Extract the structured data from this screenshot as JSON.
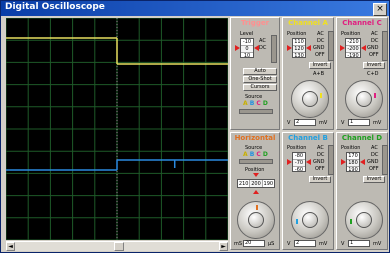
{
  "window": {
    "title": "Digital Oscilloscope",
    "close": "×"
  },
  "screen": {
    "trace_colors": {
      "A": "#e8e060",
      "B": "#2a8ae0"
    }
  },
  "scrollbar": {
    "left": "◄",
    "right": "►"
  },
  "trigger": {
    "title": "Trigger",
    "level_label": "Level",
    "level_values": [
      "-10",
      "0",
      "10"
    ],
    "ac": "AC",
    "dc": "DC",
    "auto": "Auto",
    "one_shot": "One-Shot",
    "cursors": "Cursors",
    "source_label": "Source",
    "source_letters": [
      "A",
      "B",
      "C",
      "D"
    ]
  },
  "channel_a": {
    "title": "Channel A",
    "color": "#f0e020",
    "position_label": "Position",
    "position_values": [
      "110",
      "120",
      "130"
    ],
    "modes": [
      "AC",
      "DC",
      "GND",
      "OFF"
    ],
    "invert": "Invert",
    "combo": "A+B",
    "scale_unit": "V",
    "scale_value": "2",
    "scale_small": "mV"
  },
  "channel_c": {
    "title": "Channel C",
    "color": "#e02080",
    "position_label": "Position",
    "position_values": [
      "-210",
      "-200",
      "-190"
    ],
    "modes": [
      "AC",
      "DC",
      "GND",
      "OFF"
    ],
    "invert": "Invert",
    "combo": "C+D",
    "scale_unit": "V",
    "scale_value": "1",
    "scale_small": "mV"
  },
  "horizontal": {
    "title": "Horizontal",
    "source_label": "Source",
    "source_letters": [
      "A",
      "B",
      "C",
      "D"
    ],
    "position_label": "Position",
    "position_values": [
      "210",
      "200",
      "190"
    ],
    "scale_unit": "mS",
    "scale_value": "20",
    "scale_small": "μS"
  },
  "channel_b": {
    "title": "Channel B",
    "color": "#20a0e0",
    "position_label": "Position",
    "position_values": [
      "-80",
      "-70",
      "-60"
    ],
    "modes": [
      "AC",
      "DC",
      "GND",
      "OFF"
    ],
    "invert": "Invert",
    "scale_unit": "V",
    "scale_value": "2",
    "scale_small": "mV"
  },
  "channel_d": {
    "title": "Channel D",
    "color": "#20a020",
    "position_label": "Position",
    "position_values": [
      "170",
      "180",
      "190"
    ],
    "modes": [
      "AC",
      "DC",
      "GND",
      "OFF"
    ],
    "invert": "Invert",
    "scale_unit": "V",
    "scale_value": "1",
    "scale_small": "mV"
  }
}
